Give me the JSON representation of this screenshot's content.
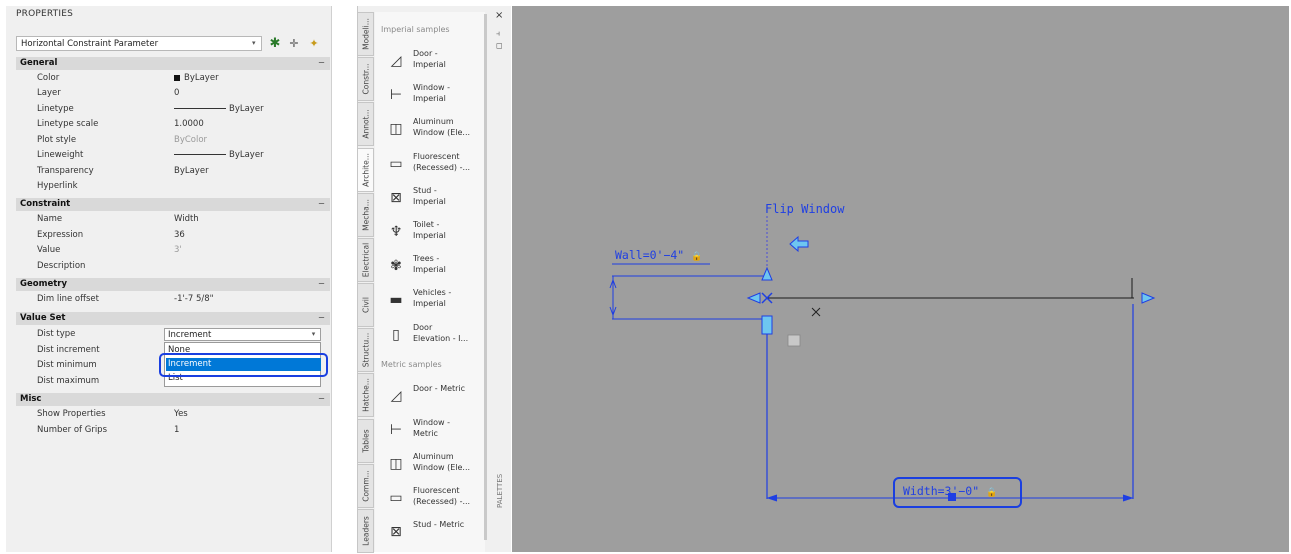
{
  "properties": {
    "title": "PROPERTIES",
    "selector": "Horizontal Constraint Parameter",
    "sections": {
      "general": "General",
      "constraint": "Constraint",
      "geometry": "Geometry",
      "value_set": "Value Set",
      "misc": "Misc"
    },
    "collapse_glyph": "−",
    "general": {
      "color_k": "Color",
      "color_v": "ByLayer",
      "layer_k": "Layer",
      "layer_v": "0",
      "linetype_k": "Linetype",
      "linetype_v": "ByLayer",
      "linetype_scale_k": "Linetype scale",
      "linetype_scale_v": "1.0000",
      "plot_style_k": "Plot style",
      "plot_style_v": "ByColor",
      "lineweight_k": "Lineweight",
      "lineweight_v": "ByLayer",
      "transparency_k": "Transparency",
      "transparency_v": "ByLayer",
      "hyperlink_k": "Hyperlink"
    },
    "constraint": {
      "name_k": "Name",
      "name_v": "Width",
      "expression_k": "Expression",
      "expression_v": "36",
      "value_k": "Value",
      "value_v": "3'",
      "description_k": "Description"
    },
    "geometry": {
      "dim_offset_k": "Dim line offset",
      "dim_offset_v": "-1'-7 5/8\""
    },
    "value_set": {
      "dist_type_k": "Dist type",
      "dist_type_v": "Increment",
      "dist_increment_k": "Dist increment",
      "dist_minimum_k": "Dist minimum",
      "dist_maximum_k": "Dist maximum",
      "options": [
        "None",
        "Increment",
        "List"
      ]
    },
    "misc": {
      "show_props_k": "Show Properties",
      "show_props_v": "Yes",
      "grips_k": "Number of Grips",
      "grips_v": "1"
    }
  },
  "palette": {
    "tabs": [
      "Modeli...",
      "Constr...",
      "Annot...",
      "Archite...",
      "Mecha...",
      "Electrical",
      "Civil",
      "Structu...",
      "Hatche...",
      "Tables",
      "Comm...",
      "Leaders"
    ],
    "imperial_header": "Imperial samples",
    "metric_header": "Metric samples",
    "imperial_items": [
      {
        "label": "Door -\nImperial",
        "icon": "door-icon"
      },
      {
        "label": "Window -\nImperial",
        "icon": "window-icon"
      },
      {
        "label": "Aluminum\nWindow (Ele...",
        "icon": "aluminum-window-icon"
      },
      {
        "label": "Fluorescent\n(Recessed) -...",
        "icon": "fluorescent-icon"
      },
      {
        "label": "Stud -\nImperial",
        "icon": "stud-icon"
      },
      {
        "label": "Toilet -\nImperial",
        "icon": "toilet-icon"
      },
      {
        "label": "Trees -\nImperial",
        "icon": "tree-icon"
      },
      {
        "label": "Vehicles -\nImperial",
        "icon": "vehicle-icon"
      },
      {
        "label": "Door\nElevation - I...",
        "icon": "door-elevation-icon"
      }
    ],
    "metric_items": [
      {
        "label": "Door - Metric",
        "icon": "door-icon"
      },
      {
        "label": "Window -\nMetric",
        "icon": "window-icon"
      },
      {
        "label": "Aluminum\nWindow (Ele...",
        "icon": "aluminum-window-icon"
      },
      {
        "label": "Fluorescent\n(Recessed) -...",
        "icon": "fluorescent-icon"
      },
      {
        "label": "Stud - Metric",
        "icon": "stud-icon"
      }
    ],
    "close_glyph": "×",
    "side_label": "PALETTES"
  },
  "drawing": {
    "flip_label": "Flip Window",
    "wall_label": "Wall=0'−4\"",
    "width_label": "Width=3'−0\"",
    "lock_glyph": "🔒",
    "colors": {
      "background": "#9e9e9e",
      "constraint_blue": "#1f3fe3",
      "grip_cyan": "#6ec6f0",
      "highlight_blue": "#1a3fe0",
      "selection_blue": "#0078d7"
    }
  }
}
